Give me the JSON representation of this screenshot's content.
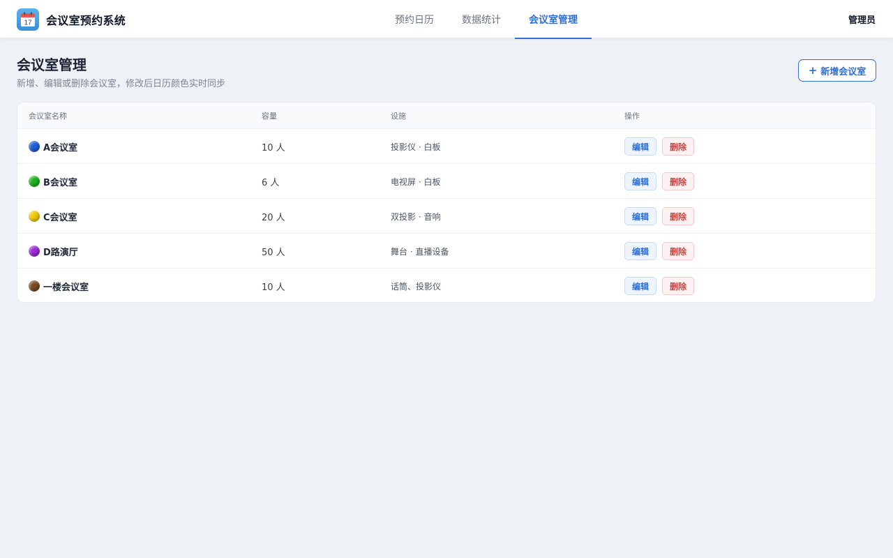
{
  "app": {
    "title": "会议室预约系统",
    "logo_icon": "calendar-icon",
    "logo_day": "17"
  },
  "nav": {
    "tabs": [
      {
        "label": "预约日历",
        "active": false
      },
      {
        "label": "数据统计",
        "active": false
      },
      {
        "label": "会议室管理",
        "active": true
      }
    ]
  },
  "user": {
    "label": "管理员"
  },
  "page": {
    "title": "会议室管理",
    "subtitle": "新增、编辑或删除会议室，修改后日历颜色实时同步",
    "add_button": {
      "icon": "plus-icon",
      "plus": "+",
      "label": "新增会议室"
    }
  },
  "table": {
    "headers": [
      "会议室名称",
      "容量",
      "设施",
      "操作"
    ],
    "rows": [
      {
        "name": "A会议室",
        "color": "#1f5fd6",
        "capacity": "10 人",
        "facilities": "投影仪 · 白板",
        "edit": "编辑",
        "delete": "删除"
      },
      {
        "name": "B会议室",
        "color": "#1db31d",
        "capacity": "6 人",
        "facilities": "电视屏 · 白板",
        "edit": "编辑",
        "delete": "删除"
      },
      {
        "name": "C会议室",
        "color": "#f2cc00",
        "capacity": "20 人",
        "facilities": "双投影 · 音响",
        "edit": "编辑",
        "delete": "删除"
      },
      {
        "name": "D路演厅",
        "color": "#9b2bd8",
        "capacity": "50 人",
        "facilities": "舞台 · 直播设备",
        "edit": "编辑",
        "delete": "删除"
      },
      {
        "name": "一楼会议室",
        "color": "#7a4a22",
        "capacity": "10 人",
        "facilities": "话筒、投影仪",
        "edit": "编辑",
        "delete": "删除"
      }
    ]
  },
  "colors": {
    "accent": "#2f6fd6",
    "danger": "#d64040",
    "background": "#eef2f6"
  }
}
